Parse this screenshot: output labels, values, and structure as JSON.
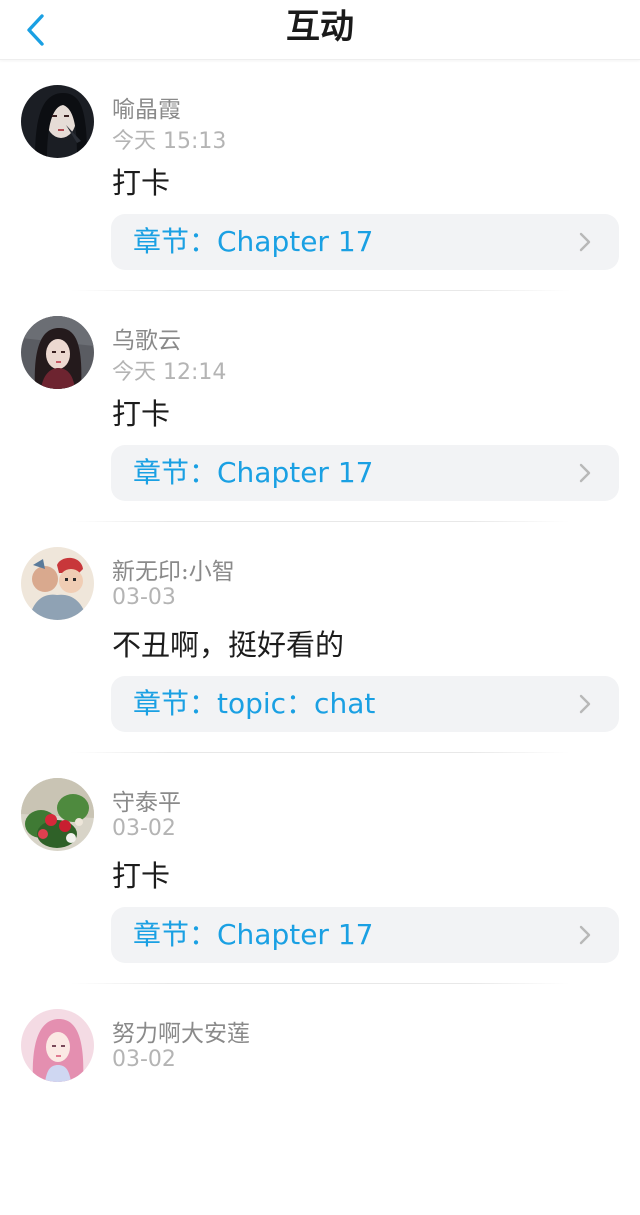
{
  "header": {
    "title": "互动",
    "back_icon": "chevron-left-icon",
    "accent_color": "#1aa0e3"
  },
  "items": [
    {
      "user": "喻晶霞",
      "time": "今天 15:13",
      "comment": "打卡",
      "chapter": "章节：Chapter 17",
      "avatar": "avatar-dark-portrait"
    },
    {
      "user": "乌歌云",
      "time": "今天 12:14",
      "comment": "打卡",
      "chapter": "章节：Chapter 17",
      "avatar": "avatar-girl-portrait"
    },
    {
      "user": "新无印:小智",
      "time": "03-03",
      "comment": "不丑啊，挺好看的",
      "chapter": "章节：topic：chat",
      "avatar": "avatar-cartoon"
    },
    {
      "user": "守泰平",
      "time": "03-02",
      "comment": "打卡",
      "chapter": "章节：Chapter 17",
      "avatar": "avatar-flowers"
    },
    {
      "user": "努力啊大安莲",
      "time": "03-02",
      "comment": "",
      "chapter": "",
      "avatar": "avatar-pink-hair"
    }
  ]
}
